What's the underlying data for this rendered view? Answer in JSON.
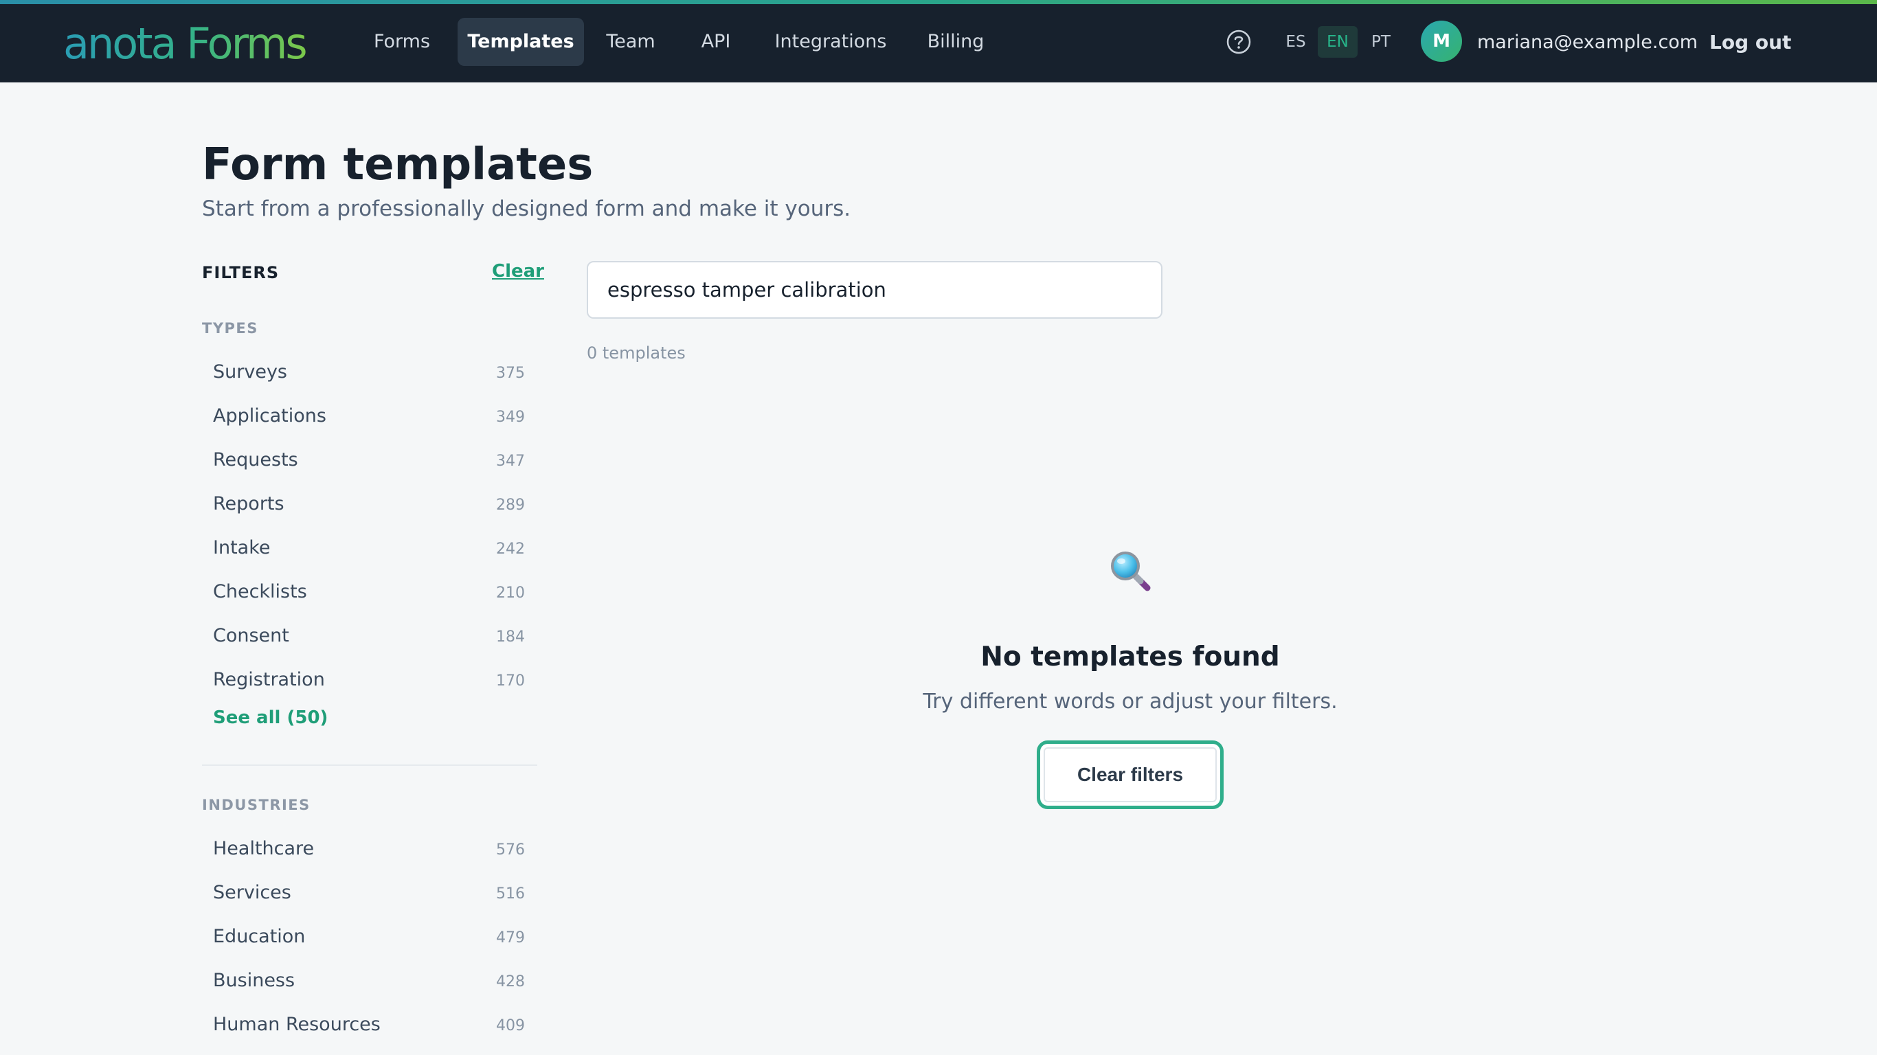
{
  "brand": {
    "logo_text": "anota Forms"
  },
  "nav": {
    "items": [
      {
        "label": "Forms",
        "active": false
      },
      {
        "label": "Templates",
        "active": true
      },
      {
        "label": "Team",
        "active": false
      },
      {
        "label": "API",
        "active": false
      },
      {
        "label": "Integrations",
        "active": false
      },
      {
        "label": "Billing",
        "active": false
      }
    ]
  },
  "header": {
    "help_icon": "question-circle-icon",
    "languages": [
      {
        "code": "ES",
        "active": false
      },
      {
        "code": "EN",
        "active": true
      },
      {
        "code": "PT",
        "active": false
      }
    ],
    "avatar_initial": "M",
    "email": "mariana@example.com",
    "logout_label": "Log out"
  },
  "page": {
    "title": "Form templates",
    "subtitle": "Start from a professionally designed form and make it yours."
  },
  "filters": {
    "heading": "FILTERS",
    "clear_label": "Clear",
    "types": {
      "heading": "TYPES",
      "items": [
        {
          "label": "Surveys",
          "count": "375"
        },
        {
          "label": "Applications",
          "count": "349"
        },
        {
          "label": "Requests",
          "count": "347"
        },
        {
          "label": "Reports",
          "count": "289"
        },
        {
          "label": "Intake",
          "count": "242"
        },
        {
          "label": "Checklists",
          "count": "210"
        },
        {
          "label": "Consent",
          "count": "184"
        },
        {
          "label": "Registration",
          "count": "170"
        }
      ],
      "see_all_label": "See all (50)"
    },
    "industries": {
      "heading": "INDUSTRIES",
      "items": [
        {
          "label": "Healthcare",
          "count": "576"
        },
        {
          "label": "Services",
          "count": "516"
        },
        {
          "label": "Education",
          "count": "479"
        },
        {
          "label": "Business",
          "count": "428"
        },
        {
          "label": "Human Resources",
          "count": "409"
        }
      ]
    }
  },
  "search": {
    "value": "espresso tamper calibration",
    "result_count": "0 templates"
  },
  "empty_state": {
    "icon": "magnifying-glass-icon",
    "title": "No templates found",
    "text": "Try different words or adjust your filters.",
    "button_label": "Clear filters"
  },
  "colors": {
    "navbar_bg": "#17212d",
    "accent": "#1f9e78",
    "active_nav_bg": "#2c3a49"
  }
}
